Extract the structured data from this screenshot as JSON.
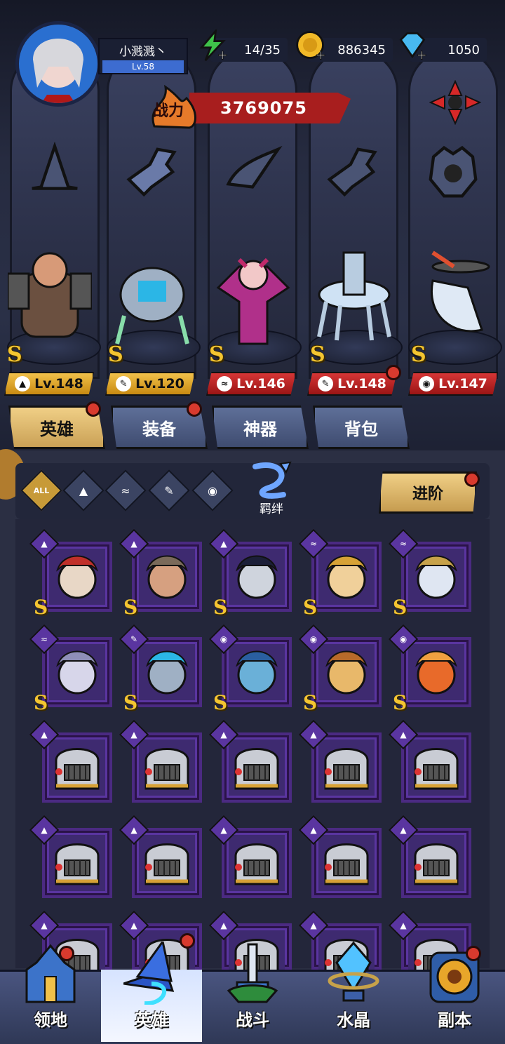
{
  "player": {
    "name": "小溅溅丶",
    "level": "Lv.58"
  },
  "resources": {
    "energy": "14/35",
    "gold": "886345",
    "diamond": "1050"
  },
  "power": {
    "label": "战力",
    "value": "3769075"
  },
  "team": [
    {
      "rank": "S",
      "level": "Lv.148",
      "class_icon": "hat-icon",
      "style": "gold"
    },
    {
      "rank": "S",
      "level": "Lv.120",
      "class_icon": "wrench-icon",
      "style": "gold"
    },
    {
      "rank": "S",
      "level": "Lv.146",
      "class_icon": "wing-icon",
      "style": "red"
    },
    {
      "rank": "S",
      "level": "Lv.148",
      "class_icon": "wrench-icon",
      "style": "red"
    },
    {
      "rank": "S",
      "level": "Lv.147",
      "class_icon": "beast-icon",
      "style": "red"
    }
  ],
  "top_tabs": [
    "英雄",
    "装备",
    "神器",
    "背包"
  ],
  "filters": {
    "all": "ALL",
    "bond": "羁绊",
    "advance": "进阶"
  },
  "roster": [
    {
      "class": "hat-icon",
      "rank": "S"
    },
    {
      "class": "hat-icon",
      "rank": "S"
    },
    {
      "class": "hat-icon",
      "rank": "S"
    },
    {
      "class": "wing-icon",
      "rank": "S"
    },
    {
      "class": "wing-icon",
      "rank": "S"
    },
    {
      "class": "wing-icon",
      "rank": "S"
    },
    {
      "class": "wrench-icon",
      "rank": "S"
    },
    {
      "class": "beast-icon",
      "rank": "S"
    },
    {
      "class": "beast-icon",
      "rank": "S"
    },
    {
      "class": "beast-icon",
      "rank": "S"
    }
  ],
  "bottom_nav": [
    "领地",
    "英雄",
    "战斗",
    "水晶",
    "副本"
  ],
  "colors": {
    "accent_gold": "#c79a38",
    "card_purple": "#5a35a0",
    "badge_red": "#d83a2e"
  }
}
